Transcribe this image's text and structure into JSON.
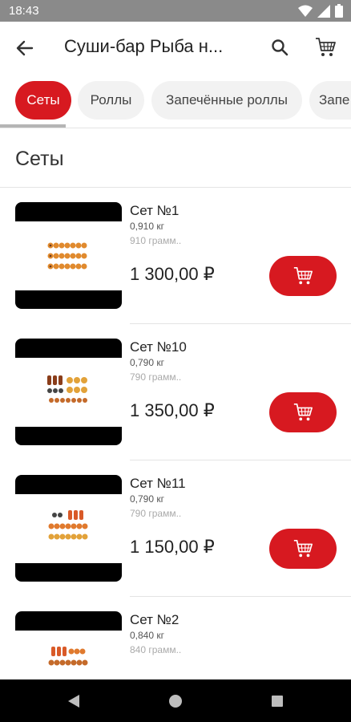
{
  "status_bar": {
    "time": "18:43"
  },
  "app_bar": {
    "title": "Суши-бар Рыба н..."
  },
  "tabs": [
    {
      "label": "Сеты",
      "active": true
    },
    {
      "label": "Роллы",
      "active": false
    },
    {
      "label": "Запечённые роллы",
      "active": false
    },
    {
      "label": "Запе",
      "active": false
    }
  ],
  "section": {
    "title": "Сеты"
  },
  "products": [
    {
      "name": "Сет №1",
      "weight": "0,910 кг",
      "description": "910 грамм..",
      "price": "1 300,00 ₽"
    },
    {
      "name": "Сет №10",
      "weight": "0,790 кг",
      "description": "790 грамм..",
      "price": "1 350,00 ₽"
    },
    {
      "name": "Сет №11",
      "weight": "0,790 кг",
      "description": "790 грамм..",
      "price": "1 150,00 ₽"
    },
    {
      "name": "Сет №2",
      "weight": "0,840 кг",
      "description": "840 грамм..",
      "price": ""
    }
  ],
  "colors": {
    "accent": "#d71920",
    "status_bar": "#8a8a8a",
    "nav_bar": "#000000"
  }
}
